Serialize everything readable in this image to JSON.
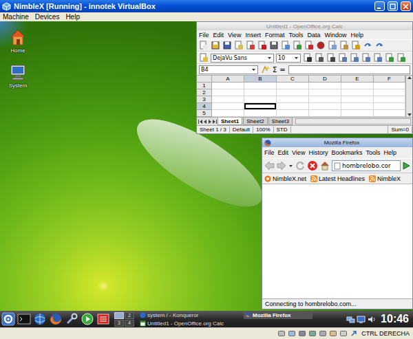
{
  "virtualbox": {
    "title": "NimbleX [Running] - innotek VirtualBox",
    "menu": [
      "Machine",
      "Devices",
      "Help"
    ],
    "host_key": "CTRL DERECHA"
  },
  "desktop_icons": [
    {
      "label": "Home"
    },
    {
      "label": "System"
    }
  ],
  "calc": {
    "title": "Untitled1 - OpenOffice.org Calc",
    "menu": [
      "File",
      "Edit",
      "View",
      "Insert",
      "Format",
      "Tools",
      "Data",
      "Window",
      "Help"
    ],
    "font_name": "DejaVu Sans",
    "font_size": "10",
    "name_box": "B4",
    "formula_icons": [
      "Σ",
      "="
    ],
    "columns": [
      {
        "label": "A",
        "selected": false
      },
      {
        "label": "B",
        "selected": true
      },
      {
        "label": "C",
        "selected": false
      },
      {
        "label": "D",
        "selected": false
      },
      {
        "label": "E",
        "selected": false
      },
      {
        "label": "F",
        "selected": false
      }
    ],
    "rows": [
      {
        "label": "1",
        "selected": false
      },
      {
        "label": "2",
        "selected": false
      },
      {
        "label": "3",
        "selected": false
      },
      {
        "label": "4",
        "selected": true
      },
      {
        "label": "5",
        "selected": false
      }
    ],
    "sheets": [
      {
        "label": "Sheet1",
        "selected": true
      },
      {
        "label": "Sheet2",
        "selected": false
      },
      {
        "label": "Sheet3",
        "selected": false
      }
    ],
    "status": [
      "Sheet 1 / 3",
      "Default",
      "100%",
      "STD",
      "Sum=0"
    ]
  },
  "firefox": {
    "title": "Mozilla Firefox",
    "menu": [
      "File",
      "Edit",
      "View",
      "History",
      "Bookmarks",
      "Tools",
      "Help"
    ],
    "url": "hombrelobo.cor",
    "bookmarks": [
      "NimbleX.net",
      "Latest Headlines",
      "NimbleX"
    ],
    "status": "Connecting to hombrelobo.com..."
  },
  "taskbar": {
    "pager": [
      {
        "selected": true
      },
      {
        "label": "2",
        "selected": false
      },
      {
        "label": "3",
        "selected": false
      },
      {
        "label": "4",
        "selected": false
      }
    ],
    "tasks": [
      {
        "label": "system / - Konqueror",
        "selected": false
      },
      {
        "label": "Untitled1 - OpenOffice.org Calc",
        "selected": false
      },
      {
        "label": "Mozilla Firefox",
        "selected": true
      }
    ],
    "clock": "10:46"
  }
}
